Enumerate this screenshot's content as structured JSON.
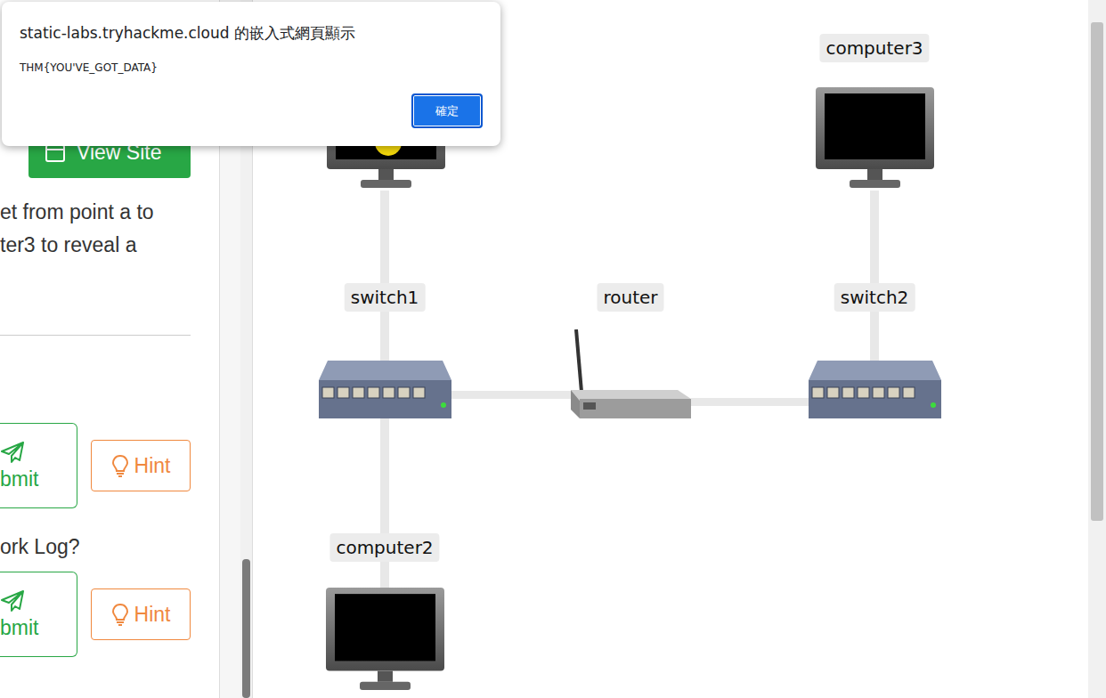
{
  "dialog": {
    "title": "static-labs.tryhackme.cloud 的嵌入式網頁顯示",
    "message": "THM{YOU'VE_GOT_DATA}",
    "button": "確定"
  },
  "task_panel": {
    "view_site_button": "View Site",
    "task_text_lines": [
      "et from point a to",
      "ter3 to reveal a"
    ],
    "questions": [
      {
        "submit": "bmit",
        "hint": "Hint"
      },
      {
        "text": "ork Log?",
        "submit": "bmit",
        "hint": "Hint"
      }
    ]
  },
  "network": {
    "nodes": [
      {
        "kind": "computer",
        "packet": true
      },
      {
        "kind": "computer",
        "label": "computer3",
        "packet": false
      },
      {
        "kind": "switch",
        "label": "switch1",
        "packet": false
      },
      {
        "kind": "router",
        "label": "router",
        "packet": false
      },
      {
        "kind": "switch",
        "label": "switch2",
        "packet": false
      },
      {
        "kind": "computer",
        "label": "computer2",
        "packet": false
      }
    ]
  }
}
